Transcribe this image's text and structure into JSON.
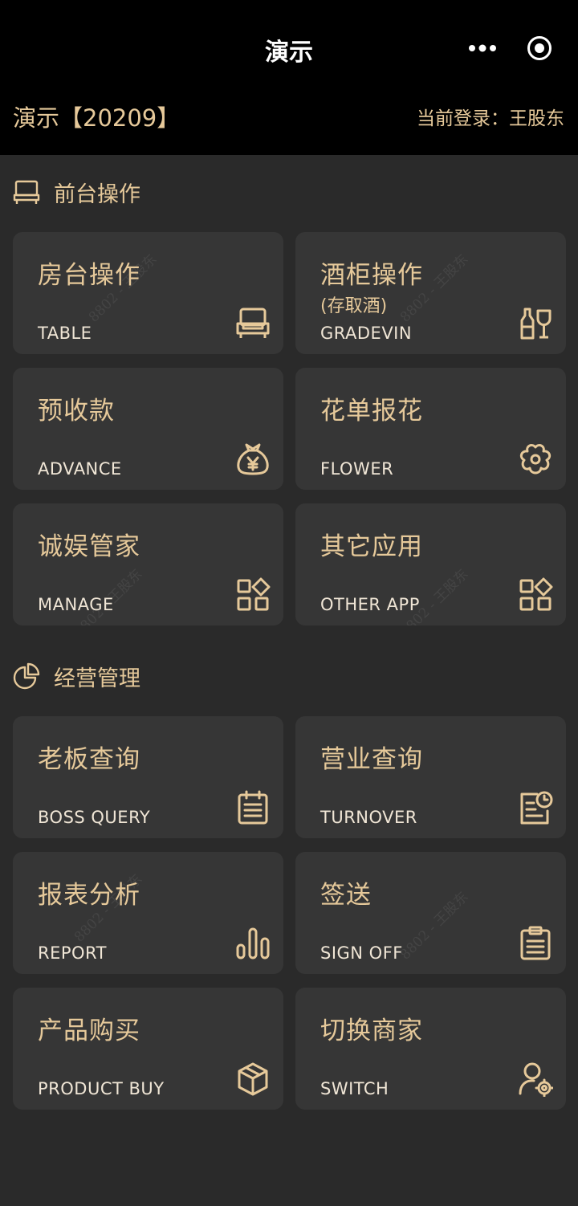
{
  "header": {
    "title": "演示",
    "shop_name": "演示【20209】",
    "login": "当前登录：王股东"
  },
  "sections": [
    {
      "title": "前台操作",
      "icon": "front-desk-icon"
    },
    {
      "title": "经营管理",
      "icon": "pie-chart-icon"
    }
  ],
  "cards": [
    {
      "cn": "房台操作",
      "sub": "",
      "en": "TABLE",
      "icon": "sofa-icon"
    },
    {
      "cn": "酒柜操作",
      "sub": "(存取酒)",
      "en": "GRADEVIN",
      "icon": "wine-bottle-glass-icon"
    },
    {
      "cn": "预收款",
      "sub": "",
      "en": "ADVANCE",
      "icon": "money-bag-icon"
    },
    {
      "cn": "花单报花",
      "sub": "",
      "en": "FLOWER",
      "icon": "flower-icon"
    },
    {
      "cn": "诚娱管家",
      "sub": "",
      "en": "MANAGE",
      "icon": "apps-grid-icon"
    },
    {
      "cn": "其它应用",
      "sub": "",
      "en": "OTHER  APP",
      "icon": "apps-grid-icon"
    },
    {
      "cn": "老板查询",
      "sub": "",
      "en": "BOSS  QUERY",
      "icon": "calendar-list-icon"
    },
    {
      "cn": "营业查询",
      "sub": "",
      "en": "TURNOVER",
      "icon": "report-clock-icon"
    },
    {
      "cn": "报表分析",
      "sub": "",
      "en": "REPORT",
      "icon": "bar-chart-icon"
    },
    {
      "cn": "签送",
      "sub": "",
      "en": "SIGN  OFF",
      "icon": "clipboard-icon"
    },
    {
      "cn": "产品购买",
      "sub": "",
      "en": "PRODUCT  BUY",
      "icon": "cube-icon"
    },
    {
      "cn": "切换商家",
      "sub": "",
      "en": "SWITCH",
      "icon": "user-settings-icon"
    }
  ],
  "watermark": "8802 - 王股东",
  "colors": {
    "accent": "#e6c99a",
    "background": "#2a2a2a",
    "card": "#363636",
    "topbar": "#000000"
  }
}
